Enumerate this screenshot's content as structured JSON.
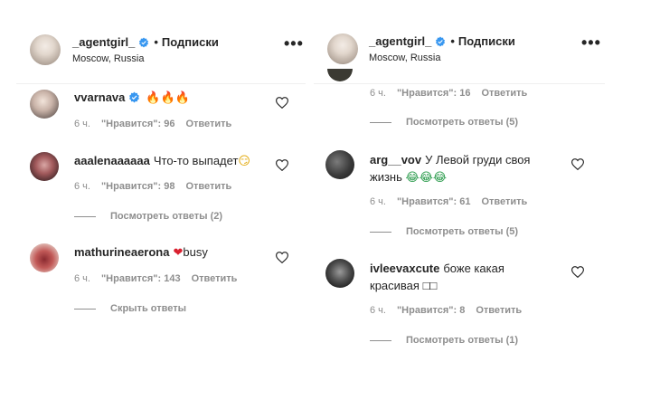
{
  "left_panel": {
    "header": {
      "username": "_agentgirl_",
      "follow_label": "Подписки",
      "location": "Moscow, Russia",
      "more": "•••"
    },
    "comments": [
      {
        "username": "vvarnava",
        "verified": true,
        "text": "",
        "emoji": "🔥🔥🔥",
        "time": "6 ч.",
        "likes": "\"Нравится\": 96",
        "reply": "Ответить"
      },
      {
        "username": "aaalenaaaaaa",
        "text": "Что-то выпадет",
        "emoji": "😏",
        "time": "6 ч.",
        "likes": "\"Нравится\": 98",
        "reply": "Ответить",
        "replies": "Посмотреть ответы (2)"
      },
      {
        "username": "mathurineaerona",
        "text": "busy",
        "emoji": "❤",
        "time": "6 ч.",
        "likes": "\"Нравится\": 143",
        "reply": "Ответить",
        "replies": "Скрыть ответы"
      }
    ]
  },
  "right_panel": {
    "header": {
      "username": "_agentgirl_",
      "follow_label": "Подписки",
      "location": "Moscow, Russia",
      "more": "•••"
    },
    "partial_comment": {
      "time": "6 ч.",
      "likes": "\"Нравится\": 16",
      "reply": "Ответить",
      "replies": "Посмотреть ответы (5)"
    },
    "comments": [
      {
        "username": "arg__vov",
        "text": "У Левой груди своя жизнь",
        "emoji": "😂😂😂",
        "time": "6 ч.",
        "likes": "\"Нравится\": 61",
        "reply": "Ответить",
        "replies": "Посмотреть ответы (5)"
      },
      {
        "username": "ivleevaxcute",
        "text": "боже какая красивая",
        "emoji": "□□",
        "time": "6 ч.",
        "likes": "\"Нравится\": 8",
        "reply": "Ответить",
        "replies": "Посмотреть ответы (1)"
      }
    ]
  },
  "colors": {
    "verified": "#3897f0",
    "muted": "#8e8e8e",
    "text": "#262626"
  }
}
